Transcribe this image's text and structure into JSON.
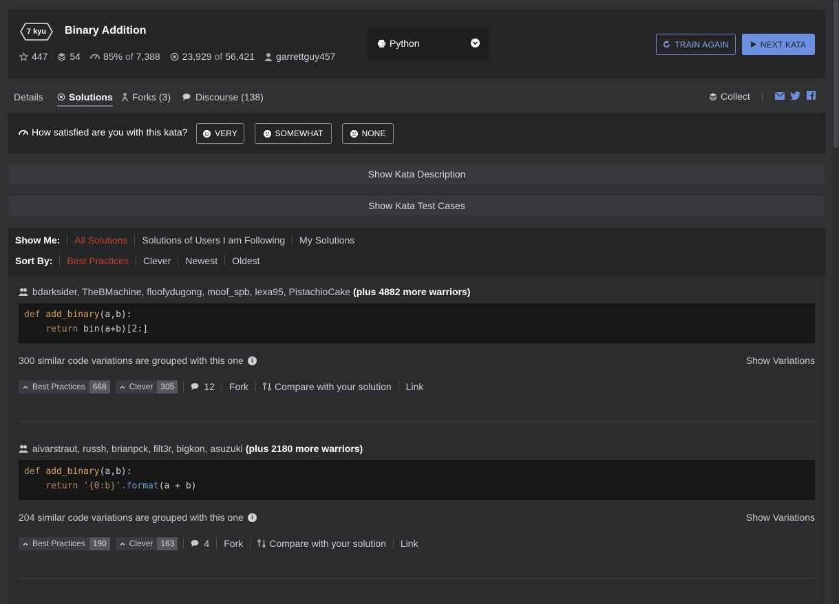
{
  "kata": {
    "rank": "7 kyu",
    "title": "Binary Addition",
    "stars": "447",
    "collections": "54",
    "satisfaction_pct": "85%",
    "of_word_1": "of",
    "satisfaction_votes": "7,388",
    "completed": "23,929",
    "of_word_2": "of",
    "attempts": "56,421",
    "author": "garrettguy457"
  },
  "language": {
    "selected": "Python"
  },
  "buttons": {
    "train_again": "TRAIN AGAIN",
    "next_kata": "NEXT KATA"
  },
  "tabs": [
    {
      "label": "Details"
    },
    {
      "label": "Solutions"
    },
    {
      "label": "Forks (3)"
    },
    {
      "label": "Discourse (138)"
    }
  ],
  "collect_label": "Collect",
  "satisfaction": {
    "question": "How satisfied are you with this kata?",
    "very": "VERY",
    "somewhat": "SOMEWHAT",
    "none": "NONE"
  },
  "show_description": "Show Kata Description",
  "show_test_cases": "Show Kata Test Cases",
  "filters": {
    "show_me_label": "Show Me:",
    "show_me": [
      "All Solutions",
      "Solutions of Users I am Following",
      "My Solutions"
    ],
    "sort_by_label": "Sort By:",
    "sort_by": [
      "Best Practices",
      "Clever",
      "Newest",
      "Oldest"
    ]
  },
  "solutions": [
    {
      "authors": "bdarksider, TheBMachine, floofydugong, moof_spb, lexa95, PistachioCake",
      "more": "(plus 4882 more warriors)",
      "code_line1": {
        "kw": "def",
        "fn": "add_binary",
        "rest": "(a,b):"
      },
      "code_line2": {
        "kw": "return",
        "rest": " bin(a+b)[2:]"
      },
      "grouped": "300 similar code variations are grouped with this one",
      "show_variations": "Show Variations",
      "best_practices": {
        "label": "Best Practices",
        "count": "668"
      },
      "clever": {
        "label": "Clever",
        "count": "305"
      },
      "comments": "12",
      "fork": "Fork",
      "compare": "Compare with your solution",
      "link": "Link"
    },
    {
      "authors": "aivarstraut, russh, brianpck, filt3r, bigkon, asuzuki",
      "more": "(plus 2180 more warriors)",
      "code_line1": {
        "kw": "def",
        "fn": "add_binary",
        "rest": "(a,b):"
      },
      "code_line2": {
        "kw": "return",
        "str": "'{0:b}'",
        "attr": ".format",
        "rest": "(a + b)"
      },
      "grouped": "204 similar code variations are grouped with this one",
      "show_variations": "Show Variations",
      "best_practices": {
        "label": "Best Practices",
        "count": "190"
      },
      "clever": {
        "label": "Clever",
        "count": "163"
      },
      "comments": "4",
      "fork": "Fork",
      "compare": "Compare with your solution",
      "link": "Link"
    }
  ],
  "colors": {
    "accent_red": "#c7402e",
    "button_blue": "#6d8fdf",
    "bg": "#303133"
  }
}
